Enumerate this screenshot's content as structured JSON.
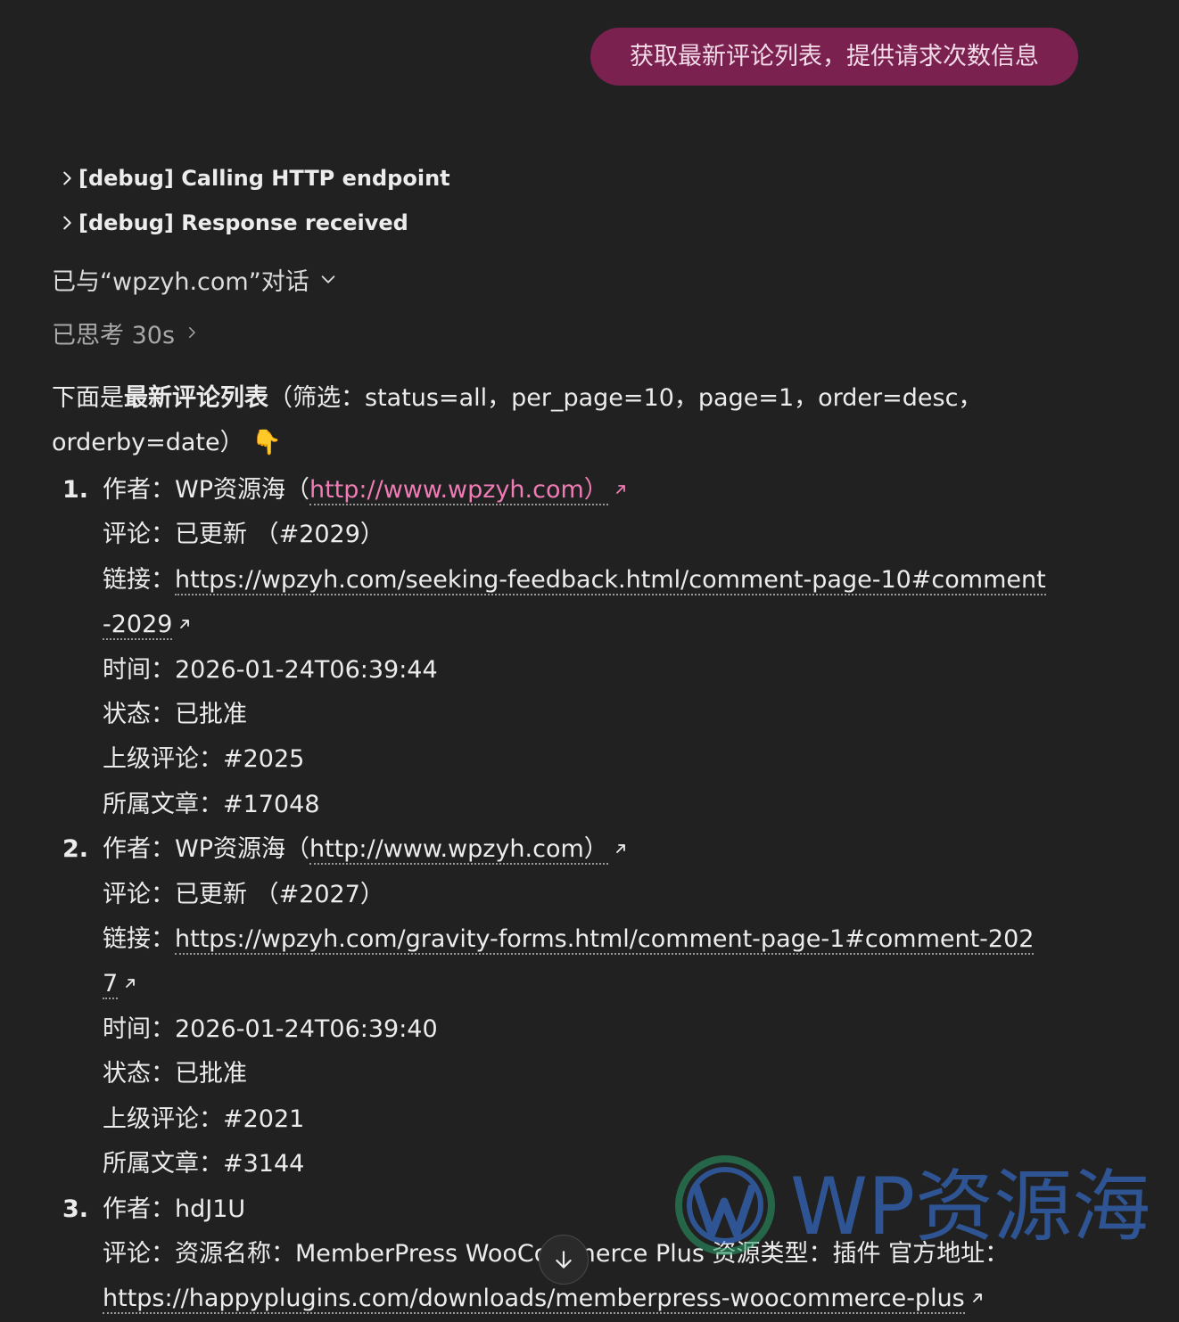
{
  "user_message": "获取最新评论列表，提供请求次数信息",
  "debug": [
    {
      "label": "[debug] Calling HTTP endpoint"
    },
    {
      "label": "[debug] Response received"
    }
  ],
  "tool_line": "已与“wpzyh.com”对话",
  "thought_line": "已思考 30s",
  "intro": {
    "prefix": "下面是",
    "bold": "最新评论列表",
    "rest": "（筛选：status=all，per_page=10，page=1，order=desc，orderby=date）",
    "emoji": "👇"
  },
  "comments": [
    {
      "num": "1.",
      "author_label": "作者：",
      "author_name": "WP资源海（",
      "author_url": "http://www.wpzyh.com）",
      "comment_label": "评论：",
      "comment_text": "已更新 （#2029）",
      "link_label": "链接：",
      "link_url": "https://wpzyh.com/seeking-feedback.html/comment-page-10#comment-2029",
      "time_label": "时间：",
      "time": "2026-01-24T06:39:44",
      "status_label": "状态：",
      "status": "已批准",
      "parent_label": "上级评论：",
      "parent": "#2025",
      "post_label": "所属文章：",
      "post": "#17048"
    },
    {
      "num": "2.",
      "author_label": "作者：",
      "author_name": "WP资源海（",
      "author_url": "http://www.wpzyh.com）",
      "comment_label": "评论：",
      "comment_text": "已更新 （#2027）",
      "link_label": "链接：",
      "link_url": "https://wpzyh.com/gravity-forms.html/comment-page-1#comment-2027",
      "time_label": "时间：",
      "time": "2026-01-24T06:39:40",
      "status_label": "状态：",
      "status": "已批准",
      "parent_label": "上级评论：",
      "parent": "#2021",
      "post_label": "所属文章：",
      "post": "#3144"
    },
    {
      "num": "3.",
      "author_label": "作者：",
      "author_name": "hdJ1U",
      "comment_label": "评论：",
      "comment_text": "资源名称：MemberPress WooCommerce Plus 资源类型：插件 官方地址：",
      "link_url": "https://happyplugins.com/downloads/memberpress-woocommerce-plus"
    }
  ],
  "watermark": "WP资源海",
  "colors": {
    "background": "#212121",
    "user_bubble": "#7a2150",
    "link_pink": "#f07bb5",
    "watermark_blue": "#3c7ff0"
  },
  "icons": {
    "debug_chevron": "chevron-right-icon",
    "tool_chevron": "chevron-down-icon",
    "external": "external-link-icon",
    "scroll": "arrow-down-icon"
  }
}
